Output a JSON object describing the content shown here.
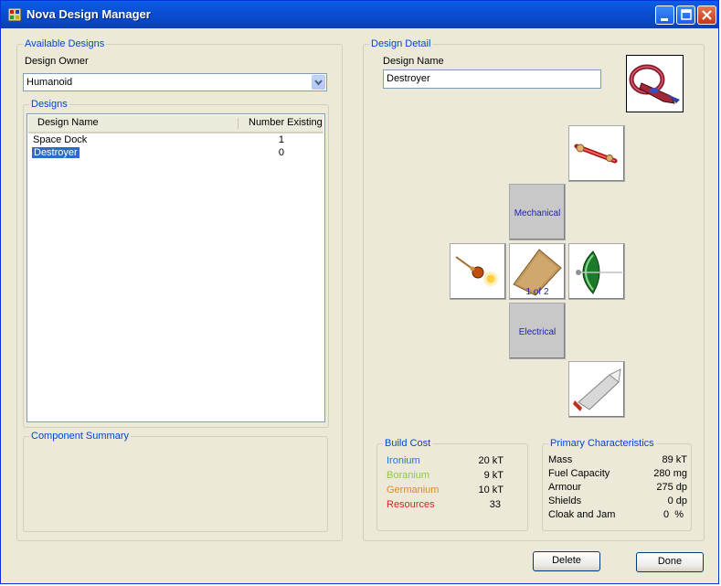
{
  "window": {
    "title": "Nova Design Manager"
  },
  "available_designs": {
    "group_label": "Available Designs",
    "owner_label": "Design Owner",
    "owner_value": "Humanoid",
    "designs_group_label": "Designs",
    "columns": [
      "Design Name",
      "Number Existing"
    ],
    "rows": [
      {
        "name": "Space Dock",
        "count": "1"
      },
      {
        "name": "Destroyer",
        "count": "0",
        "selected": true
      }
    ],
    "component_summary_label": "Component Summary"
  },
  "design_detail": {
    "group_label": "Design Detail",
    "name_label": "Design Name",
    "name_value": "Destroyer",
    "slots": {
      "mechanical": "Mechanical",
      "electrical": "Electrical",
      "armour_count": "1 of 2"
    }
  },
  "build_cost": {
    "group_label": "Build Cost",
    "items": [
      {
        "name": "Ironium",
        "value": "20",
        "unit": "kT",
        "color": "#2b6fd6"
      },
      {
        "name": "Boranium",
        "value": "9",
        "unit": "kT",
        "color": "#8ccb3a"
      },
      {
        "name": "Germanium",
        "value": "10",
        "unit": "kT",
        "color": "#e08a1a"
      },
      {
        "name": "Resources",
        "value": "33",
        "unit": "",
        "color": "#e02020"
      }
    ]
  },
  "primary": {
    "group_label": "Primary Characteristics",
    "items": [
      {
        "name": "Mass",
        "value": "89",
        "unit": "kT"
      },
      {
        "name": "Fuel Capacity",
        "value": "280",
        "unit": "mg"
      },
      {
        "name": "Armour",
        "value": "275",
        "unit": "dp"
      },
      {
        "name": "Shields",
        "value": "0",
        "unit": "dp"
      },
      {
        "name": "Cloak and Jam",
        "value": "0",
        "unit": "%"
      }
    ]
  },
  "buttons": {
    "delete": "Delete",
    "done": "Done"
  }
}
